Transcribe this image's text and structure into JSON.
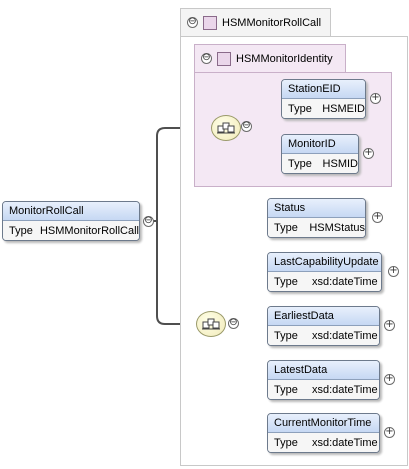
{
  "groups": {
    "outer": {
      "name": "HSMMonitorRollCall",
      "toggle": "⊖"
    },
    "inner": {
      "name": "HSMMonitorIdentity",
      "toggle": "⊖"
    }
  },
  "root": {
    "name": "MonitorRollCall",
    "type_label": "Type",
    "type_value": "HSMMonitorRollCall"
  },
  "sequence_toggle": "⊖",
  "identity_elements": [
    {
      "name": "StationEID",
      "type_label": "Type",
      "type_value": "HSMEID"
    },
    {
      "name": "MonitorID",
      "type_label": "Type",
      "type_value": "HSMID"
    }
  ],
  "elements": [
    {
      "name": "Status",
      "type_label": "Type",
      "type_value": "HSMStatus"
    },
    {
      "name": "LastCapabilityUpdate",
      "type_label": "Type",
      "type_value": "xsd:dateTime"
    },
    {
      "name": "EarliestData",
      "type_label": "Type",
      "type_value": "xsd:dateTime"
    },
    {
      "name": "LatestData",
      "type_label": "Type",
      "type_value": "xsd:dateTime"
    },
    {
      "name": "CurrentMonitorTime",
      "type_label": "Type",
      "type_value": "xsd:dateTime"
    }
  ],
  "expand_symbol": "+",
  "colors": {
    "connector": "#4f4f4f",
    "group_border": "#c8c8c8",
    "identity_fill": "#f4e8f4",
    "element_header": "#c6d8f3"
  }
}
